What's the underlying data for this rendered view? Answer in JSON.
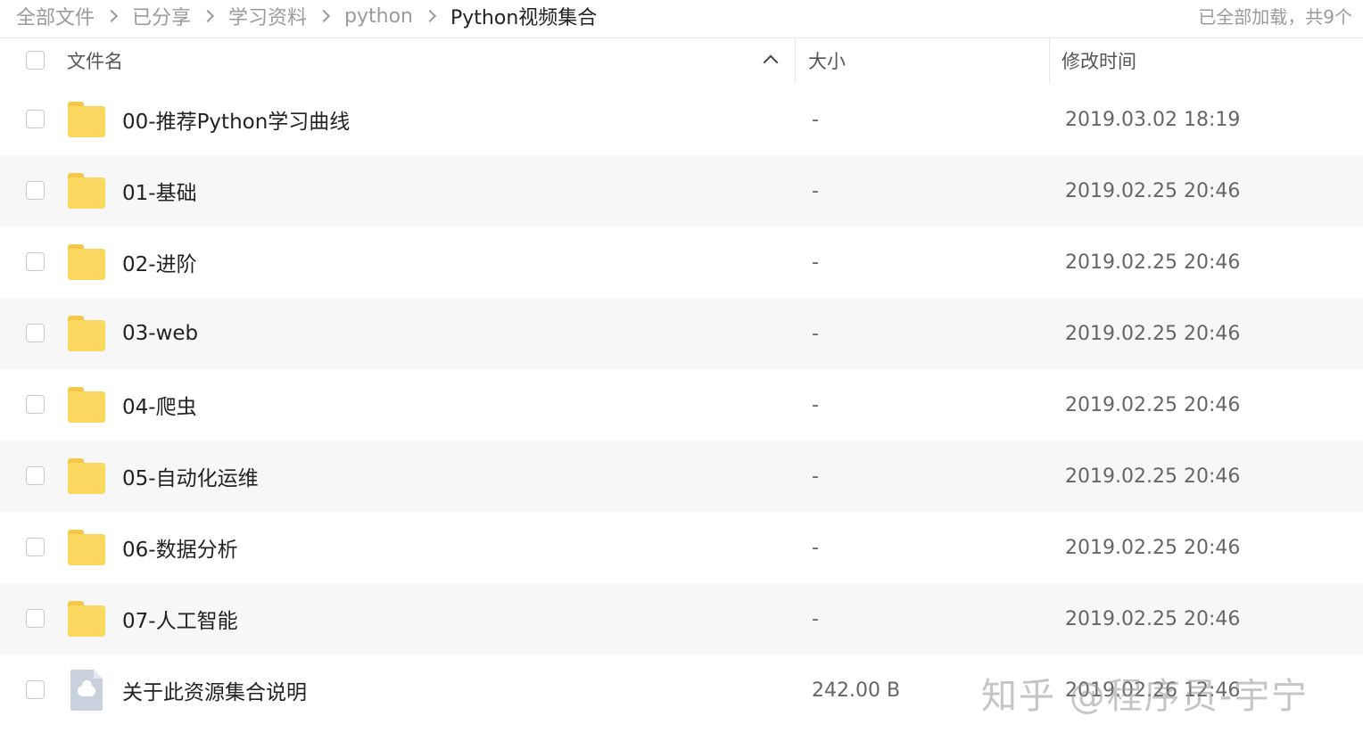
{
  "breadcrumb": {
    "items": [
      "全部文件",
      "已分享",
      "学习资料",
      "python"
    ],
    "current": "Python视频集合"
  },
  "load_status": "已全部加载，共9个",
  "columns": {
    "name": "文件名",
    "size": "大小",
    "modified": "修改时间"
  },
  "sort": {
    "column": "name",
    "direction": "ascending"
  },
  "files": [
    {
      "name": "00-推荐Python学习曲线",
      "size": "-",
      "modified": "2019.03.02 18:19",
      "type": "folder"
    },
    {
      "name": "01-基础",
      "size": "-",
      "modified": "2019.02.25 20:46",
      "type": "folder"
    },
    {
      "name": "02-进阶",
      "size": "-",
      "modified": "2019.02.25 20:46",
      "type": "folder"
    },
    {
      "name": "03-web",
      "size": "-",
      "modified": "2019.02.25 20:46",
      "type": "folder"
    },
    {
      "name": "04-爬虫",
      "size": "-",
      "modified": "2019.02.25 20:46",
      "type": "folder"
    },
    {
      "name": "05-自动化运维",
      "size": "-",
      "modified": "2019.02.25 20:46",
      "type": "folder"
    },
    {
      "name": "06-数据分析",
      "size": "-",
      "modified": "2019.02.25 20:46",
      "type": "folder"
    },
    {
      "name": "07-人工智能",
      "size": "-",
      "modified": "2019.02.25 20:46",
      "type": "folder"
    },
    {
      "name": "关于此资源集合说明",
      "size": "242.00 B",
      "modified": "2019.02.26 12:46",
      "type": "file"
    }
  ],
  "watermark": "知乎 @程序员-宇宁",
  "colors": {
    "folder": "#fcd760",
    "row_alt": "#f7f7f7",
    "muted_text": "#9b9b9b"
  }
}
